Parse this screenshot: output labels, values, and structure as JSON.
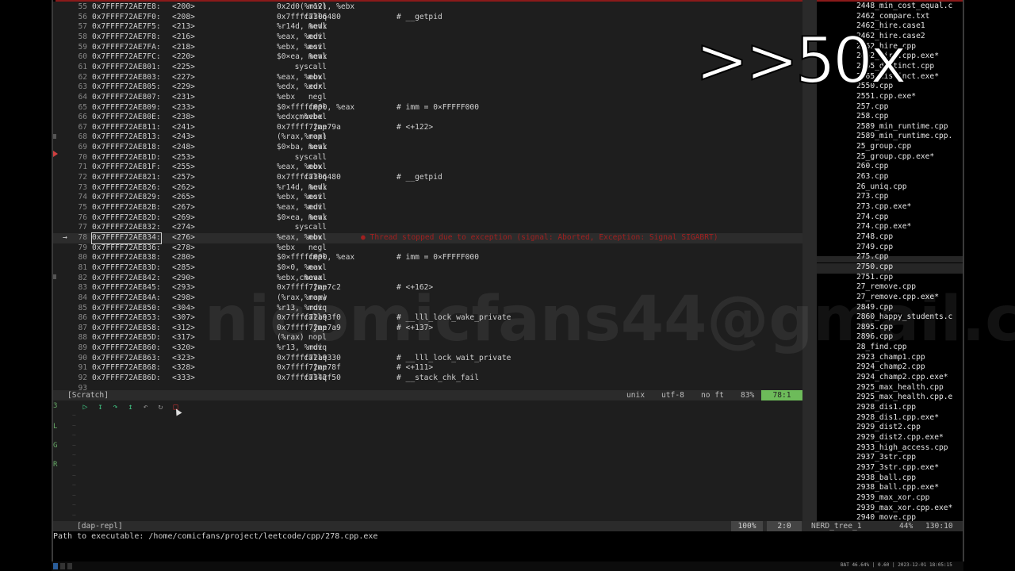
{
  "code_lines": [
    {
      "ln": "55",
      "addr": "0x7FFFF72AE7E8:",
      "off": "<200>",
      "op": "movl",
      "args": "0x2d0(%r12), %ebx",
      "comment": ""
    },
    {
      "ln": "56",
      "addr": "0x7FFFF72AE7F0:",
      "off": "<208>",
      "op": "callq",
      "args": "0x7ffff7306480",
      "comment": "# __getpid"
    },
    {
      "ln": "57",
      "addr": "0x7FFFF72AE7F5:",
      "off": "<213>",
      "op": "movl",
      "args": "%r14d, %edx",
      "comment": ""
    },
    {
      "ln": "58",
      "addr": "0x7FFFF72AE7F8:",
      "off": "<216>",
      "op": "movl",
      "args": "%eax, %edi",
      "comment": ""
    },
    {
      "ln": "59",
      "addr": "0x7FFFF72AE7FA:",
      "off": "<218>",
      "op": "movl",
      "args": "%ebx, %esi",
      "comment": ""
    },
    {
      "ln": "60",
      "addr": "0x7FFFF72AE7FC:",
      "off": "<220>",
      "op": "movl",
      "args": "$0×ea, %eax",
      "comment": ""
    },
    {
      "ln": "61",
      "addr": "0x7FFFF72AE801:",
      "off": "<225>",
      "op": "syscall",
      "args": "",
      "comment": ""
    },
    {
      "ln": "62",
      "addr": "0x7FFFF72AE803:",
      "off": "<227>",
      "op": "movl",
      "args": "%eax, %ebx",
      "comment": ""
    },
    {
      "ln": "63",
      "addr": "0x7FFFF72AE805:",
      "off": "<229>",
      "op": "xorl",
      "args": "%edx, %edx",
      "comment": ""
    },
    {
      "ln": "64",
      "addr": "0x7FFFF72AE807:",
      "off": "<231>",
      "op": "negl",
      "args": "%ebx",
      "comment": ""
    },
    {
      "ln": "65",
      "addr": "0x7FFFF72AE809:",
      "off": "<233>",
      "op": "cmpl",
      "args": "$0×fffff000, %eax",
      "comment": "# imm = 0×FFFFF000"
    },
    {
      "ln": "66",
      "addr": "0x7FFFF72AE80E:",
      "off": "<238>",
      "op": "cmovbel",
      "args": "%edx, %ebx",
      "comment": ""
    },
    {
      "ln": "67",
      "addr": "0x7FFFF72AE811:",
      "off": "<241>",
      "op": "jmp",
      "args": "0x7ffff72ae79a",
      "comment": "# <+122>"
    },
    {
      "ln": "68",
      "addr": "0x7FFFF72AE813:",
      "off": "<243>",
      "op": "nopl",
      "args": "(%rax,%rax)",
      "comment": ""
    },
    {
      "ln": "69",
      "addr": "0x7FFFF72AE818:",
      "off": "<248>",
      "op": "movl",
      "args": "$0×ba, %eax",
      "comment": ""
    },
    {
      "ln": "70",
      "addr": "0x7FFFF72AE81D:",
      "off": "<253>",
      "op": "syscall",
      "args": "",
      "comment": ""
    },
    {
      "ln": "71",
      "addr": "0x7FFFF72AE81F:",
      "off": "<255>",
      "op": "movl",
      "args": "%eax, %ebx",
      "comment": ""
    },
    {
      "ln": "72",
      "addr": "0x7FFFF72AE821:",
      "off": "<257>",
      "op": "callq",
      "args": "0x7ffff7306480",
      "comment": "# __getpid"
    },
    {
      "ln": "73",
      "addr": "0x7FFFF72AE826:",
      "off": "<262>",
      "op": "movl",
      "args": "%r14d, %edx",
      "comment": ""
    },
    {
      "ln": "74",
      "addr": "0x7FFFF72AE829:",
      "off": "<265>",
      "op": "movl",
      "args": "%ebx, %esi",
      "comment": ""
    },
    {
      "ln": "75",
      "addr": "0x7FFFF72AE82B:",
      "off": "<267>",
      "op": "movl",
      "args": "%eax, %edi",
      "comment": ""
    },
    {
      "ln": "76",
      "addr": "0x7FFFF72AE82D:",
      "off": "<269>",
      "op": "movl",
      "args": "$0×ea, %eax",
      "comment": ""
    },
    {
      "ln": "77",
      "addr": "0x7FFFF72AE832:",
      "off": "<274>",
      "op": "syscall",
      "args": "",
      "comment": ""
    },
    {
      "ln": "78",
      "addr": "0x7FFFF72AE834:",
      "off": "<276>",
      "op": "movl",
      "args": "%eax, %ebx",
      "comment": ""
    },
    {
      "ln": "79",
      "addr": "0x7FFFF72AE836:",
      "off": "<278>",
      "op": "negl",
      "args": "%ebx",
      "comment": ""
    },
    {
      "ln": "80",
      "addr": "0x7FFFF72AE838:",
      "off": "<280>",
      "op": "cmpl",
      "args": "$0×fffff000, %eax",
      "comment": "# imm = 0×FFFFF000"
    },
    {
      "ln": "81",
      "addr": "0x7FFFF72AE83D:",
      "off": "<285>",
      "op": "movl",
      "args": "$0×0, %eax",
      "comment": ""
    },
    {
      "ln": "82",
      "addr": "0x7FFFF72AE842:",
      "off": "<290>",
      "op": "cmoval",
      "args": "%ebx, %eax",
      "comment": ""
    },
    {
      "ln": "83",
      "addr": "0x7FFFF72AE845:",
      "off": "<293>",
      "op": "jmp",
      "args": "0x7ffff72ae7c2",
      "comment": "# <+162>"
    },
    {
      "ln": "84",
      "addr": "0x7FFFF72AE84A:",
      "off": "<298>",
      "op": "nopw",
      "args": "(%rax,%rax)",
      "comment": ""
    },
    {
      "ln": "85",
      "addr": "0x7FFFF72AE850:",
      "off": "<304>",
      "op": "movq",
      "args": "%r13, %rdi",
      "comment": ""
    },
    {
      "ln": "86",
      "addr": "0x7FFFF72AE853:",
      "off": "<307>",
      "op": "callq",
      "args": "0x7ffff72a93f0",
      "comment": "# __lll_lock_wake_private"
    },
    {
      "ln": "87",
      "addr": "0x7FFFF72AE858:",
      "off": "<312>",
      "op": "jmp",
      "args": "0x7ffff72ae7a9",
      "comment": "# <+137>"
    },
    {
      "ln": "88",
      "addr": "0x7FFFF72AE85D:",
      "off": "<317>",
      "op": "nopl",
      "args": "(%rax)",
      "comment": ""
    },
    {
      "ln": "89",
      "addr": "0x7FFFF72AE860:",
      "off": "<320>",
      "op": "movq",
      "args": "%r13, %rdi",
      "comment": ""
    },
    {
      "ln": "90",
      "addr": "0x7FFFF72AE863:",
      "off": "<323>",
      "op": "callq",
      "args": "0x7ffff72a9330",
      "comment": "# __lll_lock_wait_private"
    },
    {
      "ln": "91",
      "addr": "0x7FFFF72AE868:",
      "off": "<328>",
      "op": "jmp",
      "args": "0x7ffff72ae78f",
      "comment": "# <+111>"
    },
    {
      "ln": "92",
      "addr": "0x7FFFF72AE86D:",
      "off": "<333>",
      "op": "callq",
      "args": "0x7ffff7342f50",
      "comment": "# __stack_chk_fail"
    },
    {
      "ln": "93",
      "addr": "",
      "off": "",
      "op": "",
      "args": "",
      "comment": ""
    }
  ],
  "current_line_index": 23,
  "error_message": "● Thread stopped due to exception (signal: Aborted, Exception: Signal SIGABRT)",
  "code_status": {
    "buffer": "[Scratch]",
    "format": "unix",
    "encoding": "utf-8",
    "filetype": "no ft",
    "percent": "83%",
    "position": "78:1"
  },
  "tree_items": [
    "2448_min_cost_equal.c",
    "2462_compare.txt",
    "2462_hire.case1",
    "2462_hire.case2",
    "2462_hire.cpp",
    "2462_hire.cpp.exe*",
    "2465_distinct.cpp",
    "2465_distinct.exe*",
    "2550.cpp",
    "2551.cpp.exe*",
    "257.cpp",
    "258.cpp",
    "2589_min_runtime.cpp",
    "2589_min_runtime.cpp.",
    "25_group.cpp",
    "25_group.cpp.exe*",
    "260.cpp",
    "263.cpp",
    "26_uniq.cpp",
    "273.cpp",
    "273.cpp.exe*",
    "274.cpp",
    "274.cpp.exe*",
    "2748.cpp",
    "2749.cpp",
    "275.cpp",
    "2750.cpp",
    "2751.cpp",
    "27_remove.cpp",
    "27_remove.cpp.exe*",
    "2849.cpp",
    "2860_happy_students.c",
    "2895.cpp",
    "2896.cpp",
    "28_find.cpp",
    "2923_champ1.cpp",
    "2924_champ2.cpp",
    "2924_champ2.cpp.exe*",
    "2925_max_health.cpp",
    "2925_max_health.cpp.e",
    "2928_dis1.cpp",
    "2928_dis1.cpp.exe*",
    "2929_dist2.cpp",
    "2929_dist2.cpp.exe*",
    "2933_high_access.cpp",
    "2937_3str.cpp",
    "2937_3str.cpp.exe*",
    "2938_ball.cpp",
    "2938_ball.cpp.exe*",
    "2939_max_xor.cpp",
    "2939_max_xor.cpp.exe*",
    "2940_move.cpp"
  ],
  "tree_selected_index": 26,
  "repl_status": {
    "buffer": "[dap-repl]",
    "percent": "100%",
    "linecol": "2:0",
    "tree_name": "NERD_tree_1",
    "tree_percent": "44%",
    "tree_linecol": "130:10"
  },
  "cmdline": "Path to executable: /home/comicfans/project/leetcode/cpp/278.cpp.exe",
  "overlay_speed": ">>50x",
  "watermark": "nicomicfans44@gmail.com",
  "taskbar_clock": "BAT 46.64% | 0.60 | 2023-12-01 18:05:15",
  "colors": {
    "status_position_bg": "#6dbb5a",
    "error_text": "#a02020",
    "toolbar_icons": "#3fbf7f"
  }
}
